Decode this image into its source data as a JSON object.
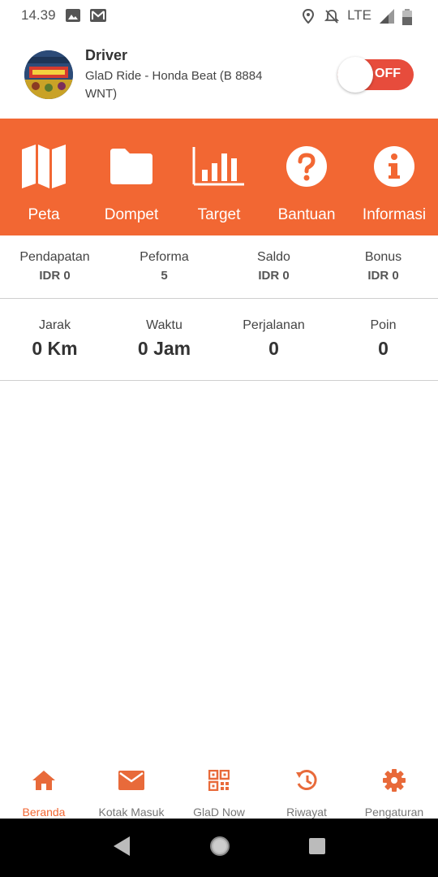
{
  "status_bar": {
    "time": "14.39",
    "network": "LTE"
  },
  "header": {
    "title": "Driver",
    "vehicle": "GlaD Ride - Honda Beat (B 8884 WNT)",
    "toggle_label": "OFF"
  },
  "menu": [
    {
      "label": "Peta",
      "icon": "map-icon"
    },
    {
      "label": "Dompet",
      "icon": "folder-icon"
    },
    {
      "label": "Target",
      "icon": "bar-chart-icon"
    },
    {
      "label": "Bantuan",
      "icon": "help-icon"
    },
    {
      "label": "Informasi",
      "icon": "info-icon"
    }
  ],
  "stats_top": [
    {
      "label": "Pendapatan",
      "value": "IDR 0"
    },
    {
      "label": "Peforma",
      "value": "5"
    },
    {
      "label": "Saldo",
      "value": "IDR 0"
    },
    {
      "label": "Bonus",
      "value": "IDR 0"
    }
  ],
  "stats_bottom": [
    {
      "label": "Jarak",
      "value": "0 Km"
    },
    {
      "label": "Waktu",
      "value": "0 Jam"
    },
    {
      "label": "Perjalanan",
      "value": "0"
    },
    {
      "label": "Poin",
      "value": "0"
    }
  ],
  "bottom_nav": [
    {
      "label": "Beranda",
      "icon": "home-icon",
      "active": true
    },
    {
      "label": "Kotak Masuk",
      "icon": "mail-icon",
      "active": false
    },
    {
      "label": "GlaD Now",
      "icon": "qr-code-icon",
      "active": false
    },
    {
      "label": "Riwayat",
      "icon": "history-icon",
      "active": false
    },
    {
      "label": "Pengaturan",
      "icon": "gear-icon",
      "active": false
    }
  ],
  "colors": {
    "accent": "#f26733",
    "toggle_off": "#e74c3c",
    "inactive_icon": "#e86a3a"
  }
}
